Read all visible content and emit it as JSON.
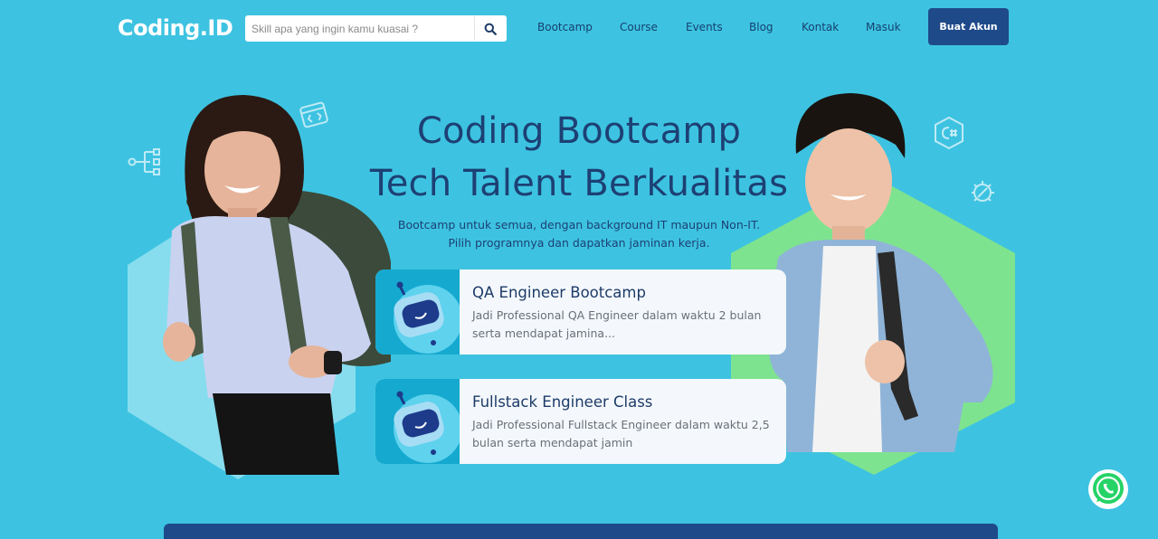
{
  "header": {
    "logo": "Coding.ID",
    "search_placeholder": "Skill apa yang ingin kamu kuasai ?",
    "nav": [
      "Bootcamp",
      "Course",
      "Events",
      "Blog",
      "Kontak",
      "Masuk"
    ],
    "cta": "Buat Akun"
  },
  "hero": {
    "title_line1": "Coding Bootcamp",
    "title_line2": "Tech Talent Berkualitas",
    "subtitle_line1": "Bootcamp untuk semua, dengan background IT maupun Non-IT.",
    "subtitle_line2": "Pilih programnya dan dapatkan jaminan kerja."
  },
  "programs": [
    {
      "title": "QA Engineer Bootcamp",
      "desc": "Jadi Professional QA Engineer dalam waktu 2 bulan serta mendapat jamina..."
    },
    {
      "title": "Fullstack Engineer Class",
      "desc": "Jadi Professional Fullstack Engineer dalam waktu 2,5 bulan serta mendapat jamin"
    }
  ],
  "colors": {
    "background": "#3dc3e1",
    "primary": "#1f4a8a",
    "card": "#f4f8fc",
    "accent_green": "#7ee38f"
  },
  "icons": [
    "search-icon",
    "code-window-icon",
    "flow-icon",
    "csharp-icon",
    "bug-icon",
    "robot-icon",
    "whatsapp-icon"
  ]
}
